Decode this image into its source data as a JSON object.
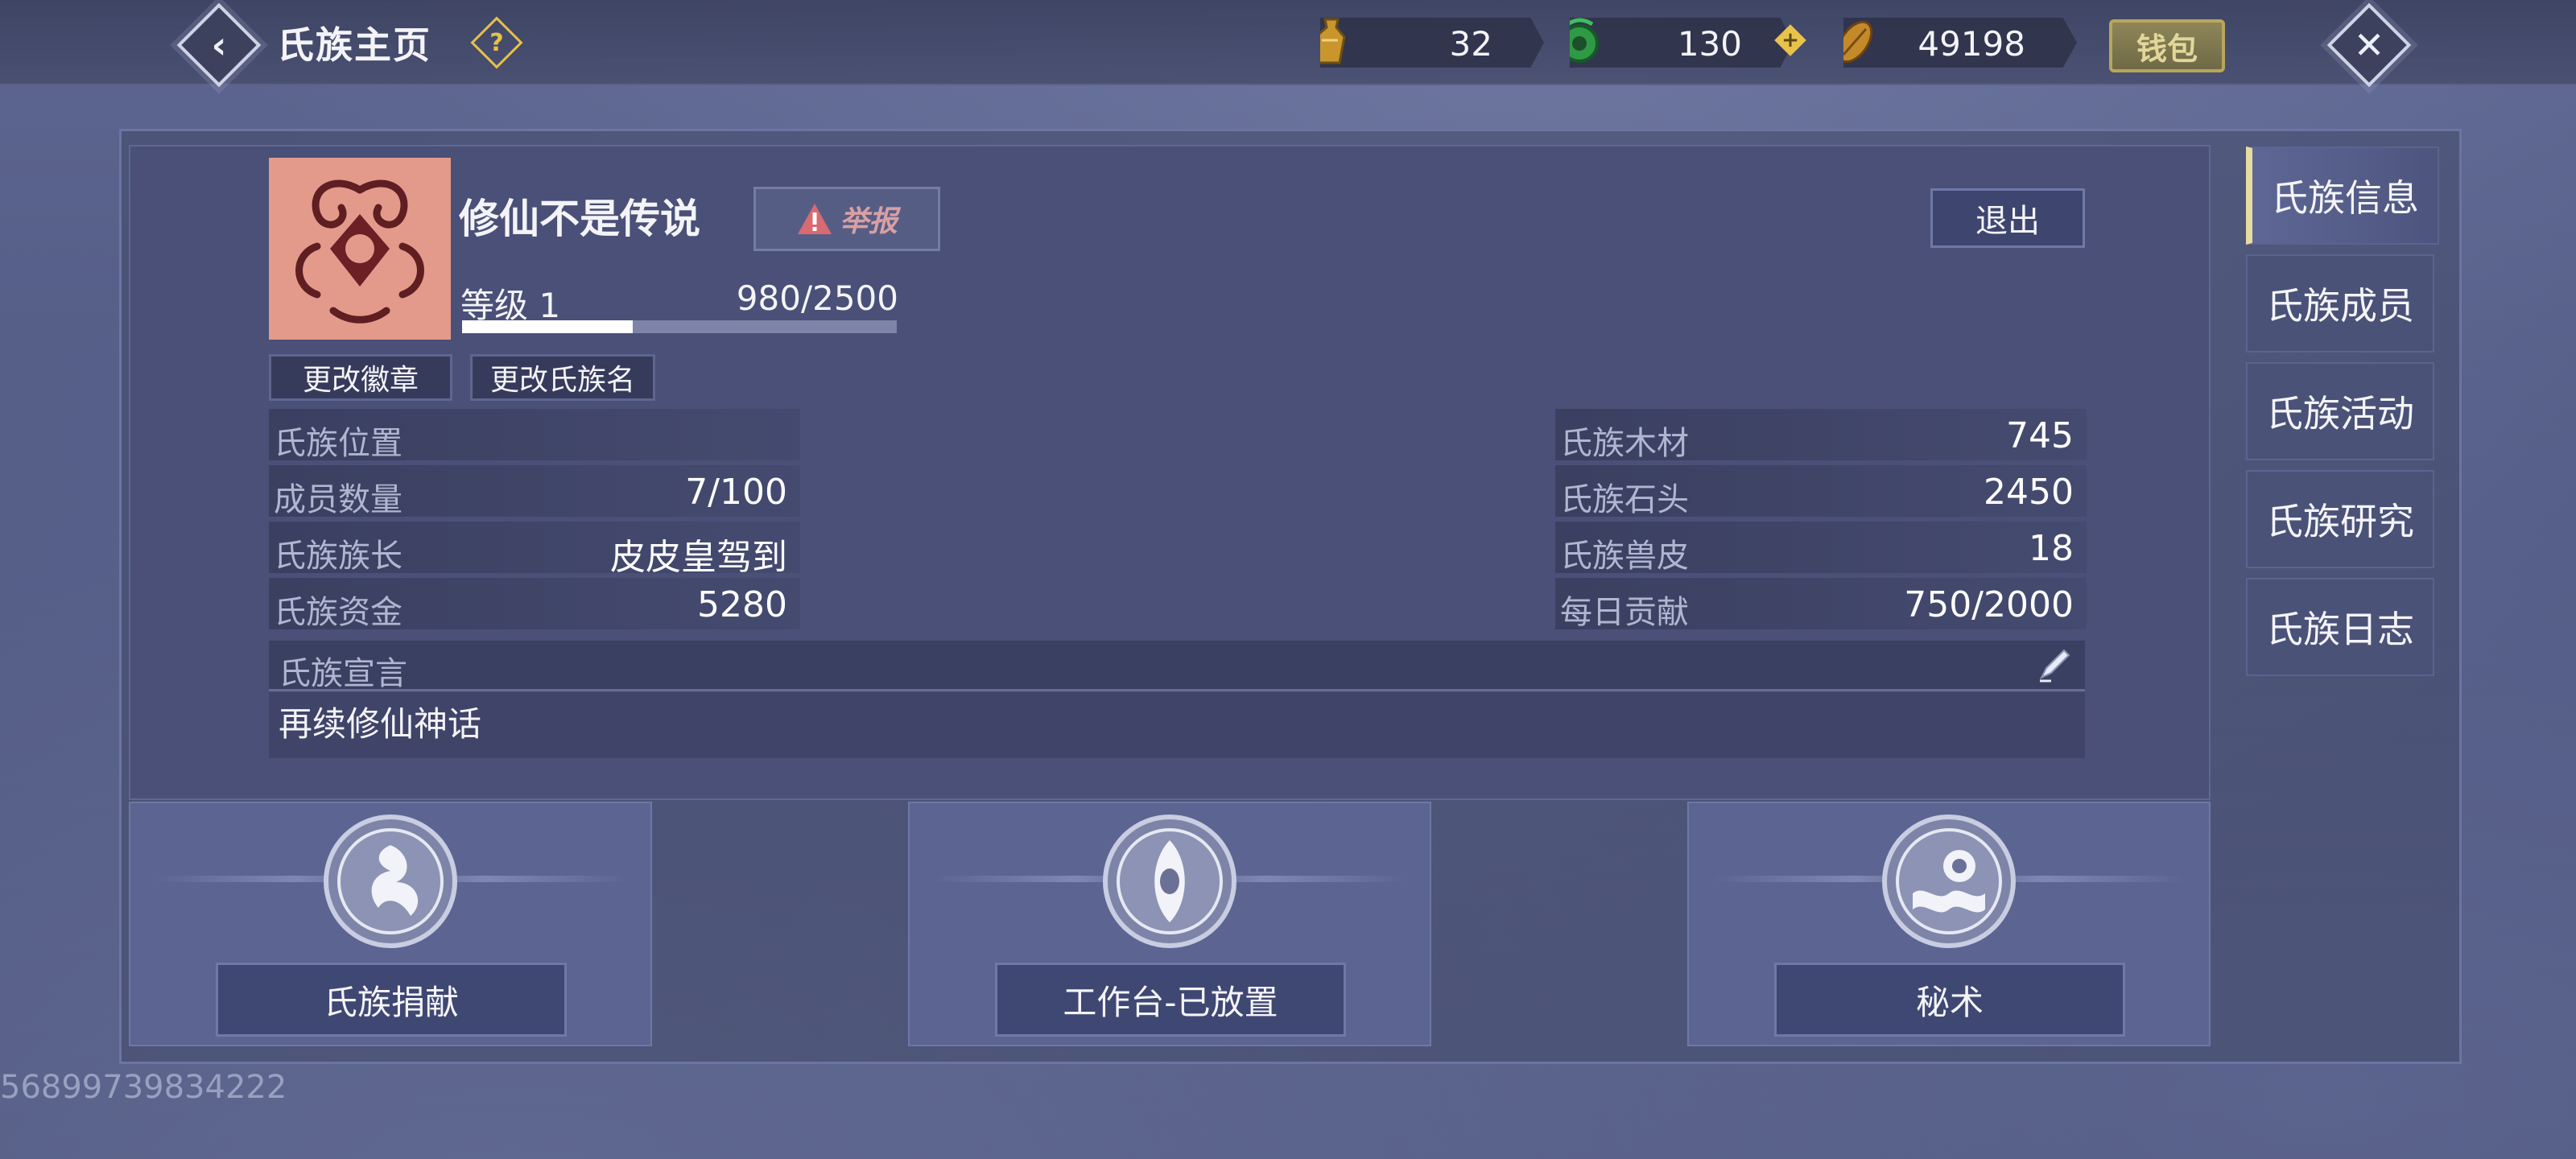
{
  "header": {
    "title": "氏族主页",
    "back_icon": "back-arrow-icon",
    "help_icon": "help-icon",
    "resources": [
      {
        "name": "gold-bottle-icon",
        "value": "32"
      },
      {
        "name": "jade-icon",
        "value": "130"
      },
      {
        "name": "seed-icon",
        "value": "49198"
      }
    ],
    "wallet_label": "钱包",
    "close_icon": "close-icon"
  },
  "clan": {
    "name": "修仙不是传说",
    "report_label": "举报",
    "exit_label": "退出",
    "level_label": "等级 1",
    "exp_text": "980/2500",
    "exp_progress": 0.392,
    "change_emblem_label": "更改徽章",
    "change_name_label": "更改氏族名"
  },
  "stats_left": [
    {
      "label": "氏族位置",
      "value": ""
    },
    {
      "label": "成员数量",
      "value": "7/100"
    },
    {
      "label": "氏族族长",
      "value": "皮皮皇驾到"
    },
    {
      "label": "氏族资金",
      "value": "5280"
    }
  ],
  "stats_right": [
    {
      "label": "氏族木材",
      "value": "745"
    },
    {
      "label": "氏族石头",
      "value": "2450"
    },
    {
      "label": "氏族兽皮",
      "value": "18"
    },
    {
      "label": "每日贡献",
      "value": "750/2000"
    }
  ],
  "declaration": {
    "label": "氏族宣言",
    "text": "再续修仙神话"
  },
  "cards": [
    {
      "label": "氏族捐献",
      "icon": "swirl-medal-icon"
    },
    {
      "label": "工作台-已放置",
      "icon": "eye-medal-icon"
    },
    {
      "label": "秘术",
      "icon": "wave-medal-icon"
    }
  ],
  "tabs": [
    {
      "label": "氏族信息",
      "active": true
    },
    {
      "label": "氏族成员",
      "active": false
    },
    {
      "label": "氏族活动",
      "active": false
    },
    {
      "label": "氏族研究",
      "active": false
    },
    {
      "label": "氏族日志",
      "active": false
    }
  ],
  "user_id": "56899739834222",
  "colors": {
    "accent_gold": "#e6c04a",
    "report_red": "#d8a0a4",
    "emblem_bg": "#e39a8a"
  }
}
